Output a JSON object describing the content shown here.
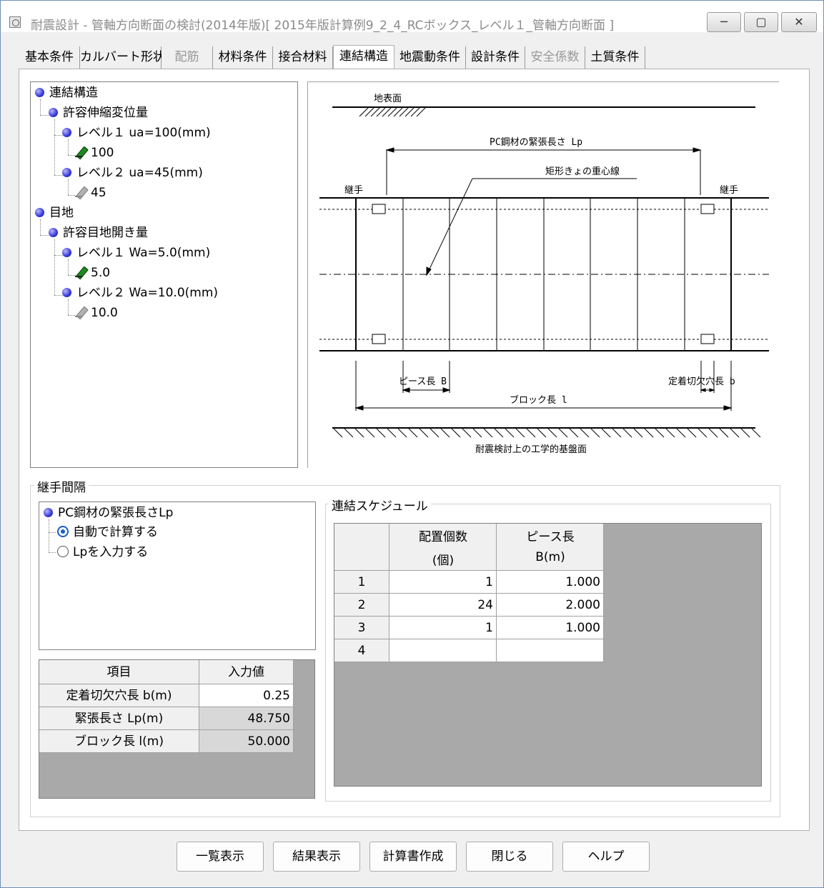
{
  "window": {
    "title": "耐震設計 - 管軸方向断面の検討(2014年版)[ 2015年版計算例9_2_4_RCボックス_レベル１_管軸方向断面 ]",
    "minimize_icon": "minimize-icon",
    "maximize_icon": "maximize-icon",
    "close_icon": "close-icon"
  },
  "tabs": [
    {
      "label": "基本条件",
      "state": "normal"
    },
    {
      "label": "カルバート形状",
      "state": "normal"
    },
    {
      "label": "配筋",
      "state": "disabled"
    },
    {
      "label": "材料条件",
      "state": "normal"
    },
    {
      "label": "接合材料",
      "state": "normal"
    },
    {
      "label": "連結構造",
      "state": "active"
    },
    {
      "label": "地震動条件",
      "state": "normal"
    },
    {
      "label": "設計条件",
      "state": "normal"
    },
    {
      "label": "安全係数",
      "state": "disabled"
    },
    {
      "label": "土質条件",
      "state": "normal"
    }
  ],
  "tree": {
    "root1": "連結構造",
    "node1": "許容伸縮変位量",
    "level1_disp": "レベル１ ua=100(mm)",
    "level1_disp_val": "100",
    "level2_disp": "レベル２ ua=45(mm)",
    "level2_disp_val": "45",
    "root2": "目地",
    "node2": "許容目地開き量",
    "level1_open": "レベル１ Wa=5.0(mm)",
    "level1_open_val": "5.0",
    "level2_open": "レベル２ Wa=10.0(mm)",
    "level2_open_val": "10.0"
  },
  "diagram": {
    "ground_surface": "地表面",
    "pc_length": "PC鋼材の緊張長さ Lp",
    "centroid_line": "矩形きょの重心線",
    "joint_left": "継手",
    "joint_right": "継手",
    "piece_length": "ピース長 B",
    "anchor_length": "定着切欠穴長 b",
    "block_length": "ブロック長 l",
    "base_surface": "耐震検討上の工学的基盤面"
  },
  "joint_spacing": {
    "title": "継手間隔",
    "option_header": "PC鋼材の緊張長さLp",
    "option_auto": "自動で計算する",
    "option_manual": "Lpを入力する",
    "table": {
      "col_item": "項目",
      "col_value": "入力値",
      "rows": [
        {
          "label": "定着切欠穴長 b(m)",
          "value": "0.25"
        },
        {
          "label": "緊張長さ Lp(m)",
          "value": "48.750"
        },
        {
          "label": "ブロック長 l(m)",
          "value": "50.000"
        }
      ]
    }
  },
  "schedule": {
    "title": "連結スケジュール",
    "col1_line1": "配置個数",
    "col1_line2": "(個)",
    "col2_line1": "ピース長",
    "col2_line2": "B(m)",
    "rows": [
      {
        "no": "1",
        "count": "1",
        "length": "1.000"
      },
      {
        "no": "2",
        "count": "24",
        "length": "2.000"
      },
      {
        "no": "3",
        "count": "1",
        "length": "1.000"
      },
      {
        "no": "4",
        "count": "",
        "length": ""
      }
    ]
  },
  "buttons": {
    "list": "一覧表示",
    "result": "結果表示",
    "report": "計算書作成",
    "close": "閉じる",
    "help": "ヘルプ"
  }
}
